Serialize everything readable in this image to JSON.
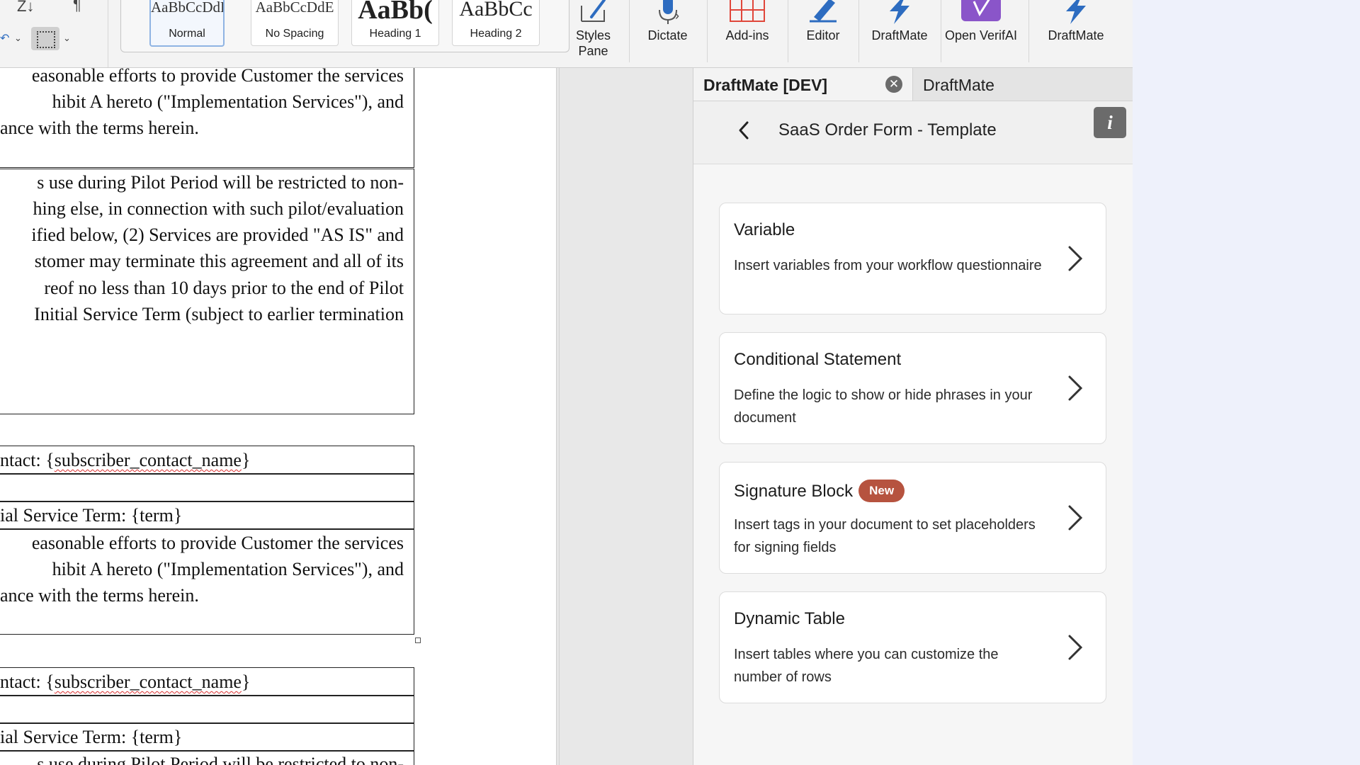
{
  "ribbon": {
    "styles": [
      {
        "sample": "AaBbCcDdE",
        "label": "Normal"
      },
      {
        "sample": "AaBbCcDdE",
        "label": "No Spacing"
      },
      {
        "sample": "AaBb(",
        "label": "Heading 1"
      },
      {
        "sample": "AaBbCc",
        "label": "Heading 2"
      }
    ],
    "buttons": {
      "styles_pane": "Styles Pane",
      "dictate": "Dictate",
      "add_ins": "Add-ins",
      "editor": "Editor",
      "draftmate_1": "DraftMate",
      "open_verifai": "Open VerifAI",
      "draftmate_2": "DraftMate"
    },
    "icons": [
      "sort-icon",
      "pilcrow-icon",
      "undo-icon",
      "borders-icon",
      "brush-icon",
      "microphone-icon",
      "grid-icon",
      "pen-icon",
      "lightning-icon",
      "shield-icon",
      "lightning-icon"
    ]
  },
  "document": {
    "lines": [
      "easonable efforts to provide Customer the services",
      "hibit A hereto (\"Implementation Services\"), and",
      "ance with the terms herein.",
      "s use during Pilot Period will be restricted to non-",
      "hing else, in connection with such pilot/evaluation",
      "ified below, (2) Services are provided \"AS IS\" and",
      "stomer may terminate this agreement and all of its",
      "reof no less than 10 days prior to the end of Pilot",
      " Initial Service Term (subject to earlier termination",
      "ntact: {",
      "subscriber_contact_name",
      "}",
      "ial Service Term: {term}",
      "easonable efforts to provide Customer the services",
      "hibit A hereto (\"Implementation Services\"), and",
      "ance with the terms herein.",
      "ntact: {",
      "subscriber_contact_name",
      "}",
      "ial Service Term: {term}",
      "s use during Pilot Period will be restricted to non-"
    ]
  },
  "pane": {
    "tabs": [
      {
        "label": "DraftMate [DEV]"
      },
      {
        "label": "DraftMate"
      }
    ],
    "close_glyph": "✕",
    "title": "SaaS Order Form - Template",
    "info_glyph": "i",
    "cards": [
      {
        "title": "Variable",
        "desc": "Insert variables from your workflow questionnaire"
      },
      {
        "title": "Conditional Statement",
        "desc": "Define the logic to show or hide phrases in your document"
      },
      {
        "title": "Signature Block",
        "badge": "New",
        "desc": "Insert tags in your document to set placeholders for signing fields"
      },
      {
        "title": "Dynamic Table",
        "desc": "Insert tables where you can customize the number of rows"
      }
    ]
  },
  "colors": {
    "accent_blue": "#2d6cc0",
    "addins_red": "#e0463a",
    "verifai_purple": "#8a55c9",
    "badge": "#b6533f"
  }
}
